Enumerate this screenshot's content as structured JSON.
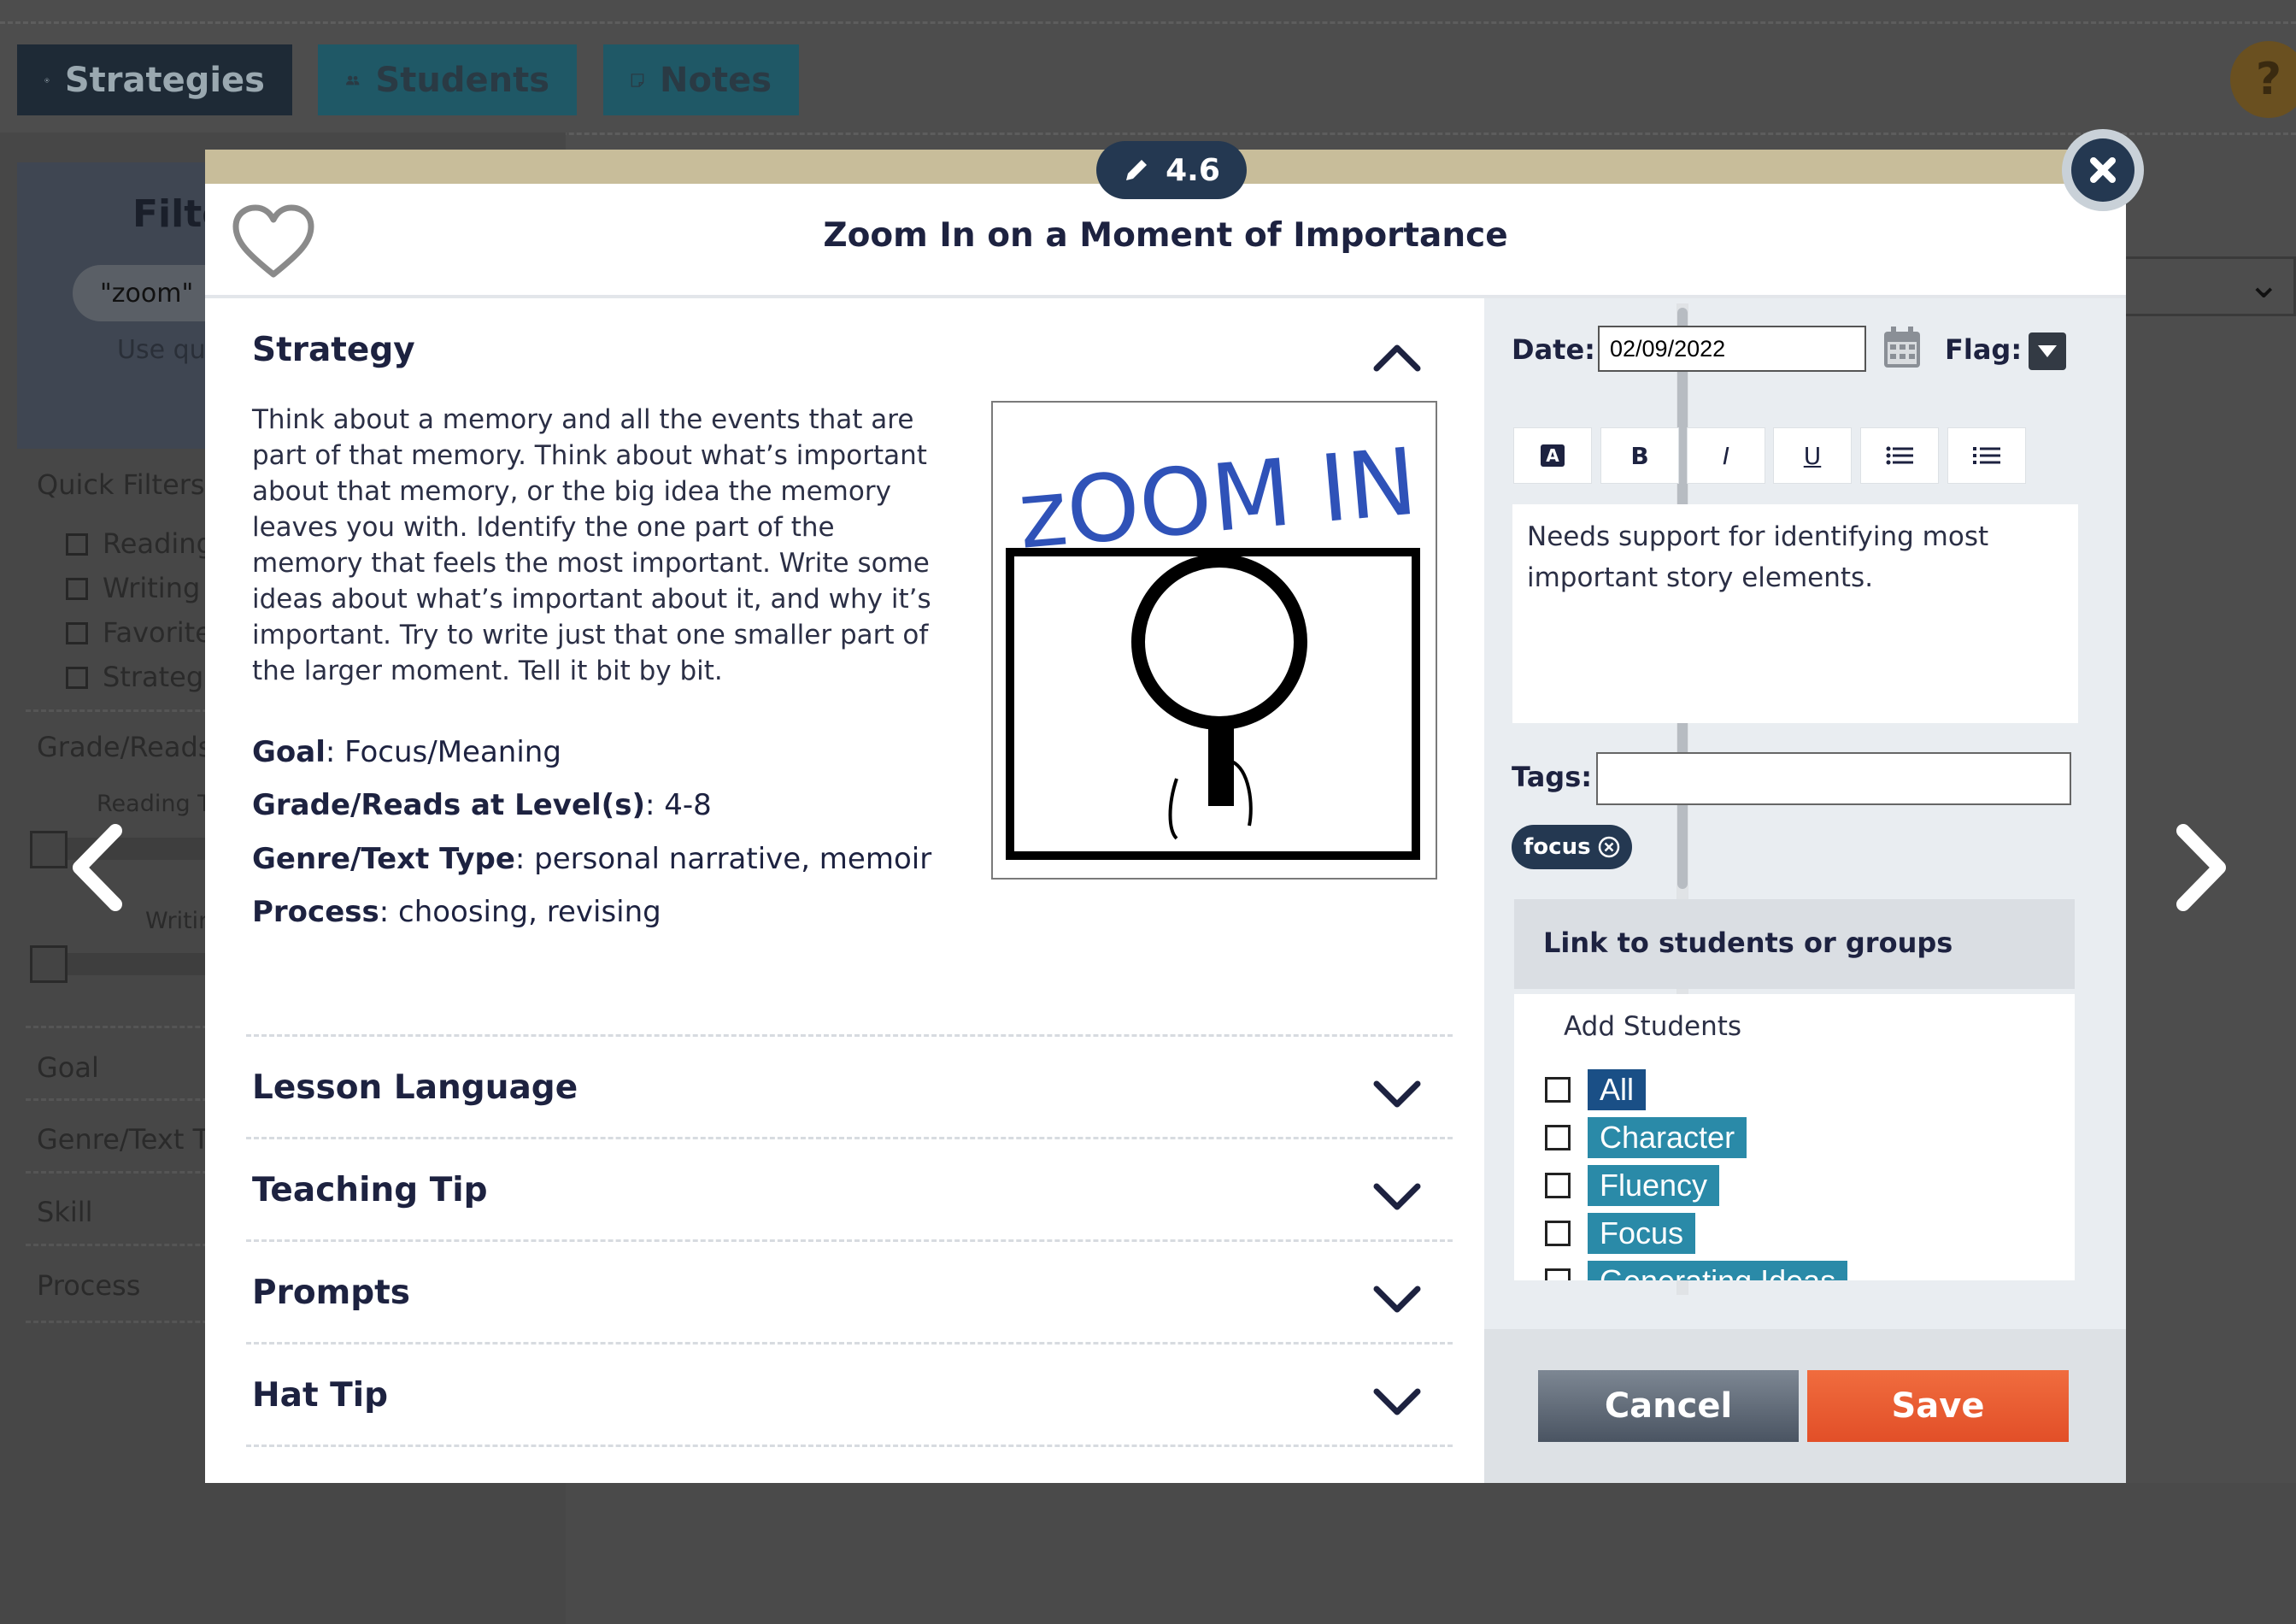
{
  "nav": {
    "strategies": "Strategies",
    "students": "Students",
    "notes": "Notes",
    "help": "?"
  },
  "background": {
    "filter_title": "Filte",
    "search_value": "\"zoom\"",
    "search_hint": "Use qu",
    "quick_filters": "Quick Filters",
    "quick_items": [
      "Reading",
      "Writing",
      "Favorite",
      "Strategi"
    ],
    "grade_reads": "Grade/Reads",
    "reading_slider_label": "Reading T",
    "writing_slider_label": "Writin",
    "facets": [
      "Goal",
      "Genre/Text T",
      "Skill",
      "Process"
    ]
  },
  "modal": {
    "version": "4.6",
    "title": "Zoom In on a Moment of Importance",
    "strategy": {
      "heading": "Strategy",
      "body": "Think about a memory and all the events that are part of that memory. Think about what’s important about that memory, or the big idea the memory leaves you with. Identify the one part of the memory that feels the most important. Write some ideas about what’s important about it, and why it’s important. Try to write just that one smaller part of the larger moment. Tell it bit by bit.",
      "image_text": "zOOM IN",
      "goal_label": "Goal",
      "goal_value": ": Focus/Meaning",
      "grade_label": "Grade/Reads at Level(s)",
      "grade_value": ": 4-8",
      "genre_label": "Genre/Text Type",
      "genre_value": ": personal narrative, memoir",
      "process_label": "Process",
      "process_value": ": choosing, revising"
    },
    "sections": {
      "lesson_language": "Lesson Language",
      "teaching_tip": "Teaching Tip",
      "prompts": "Prompts",
      "hat_tip": "Hat Tip"
    },
    "note": {
      "date_label": "Date:",
      "date_value": "02/09/2022",
      "flag_label": "Flag:",
      "toolbar": {
        "format": "A",
        "bold": "B",
        "italic": "I",
        "underline": "U"
      },
      "text": "Needs support for identifying most important story elements.",
      "tags_label": "Tags:",
      "tags_value": "",
      "tag_chip": "focus",
      "link_heading": "Link to students or groups",
      "add_students": "Add Students",
      "students": [
        "All",
        "Character",
        "Fluency",
        "Focus",
        "Generating Ideas"
      ]
    },
    "buttons": {
      "cancel": "Cancel",
      "save": "Save"
    }
  },
  "colors": {
    "navy": "#243851",
    "save": "#e8562e",
    "chip_blue": "#2a8aa8",
    "chip_all": "#1a4f86",
    "topbar_tan": "#c8bd9a"
  }
}
